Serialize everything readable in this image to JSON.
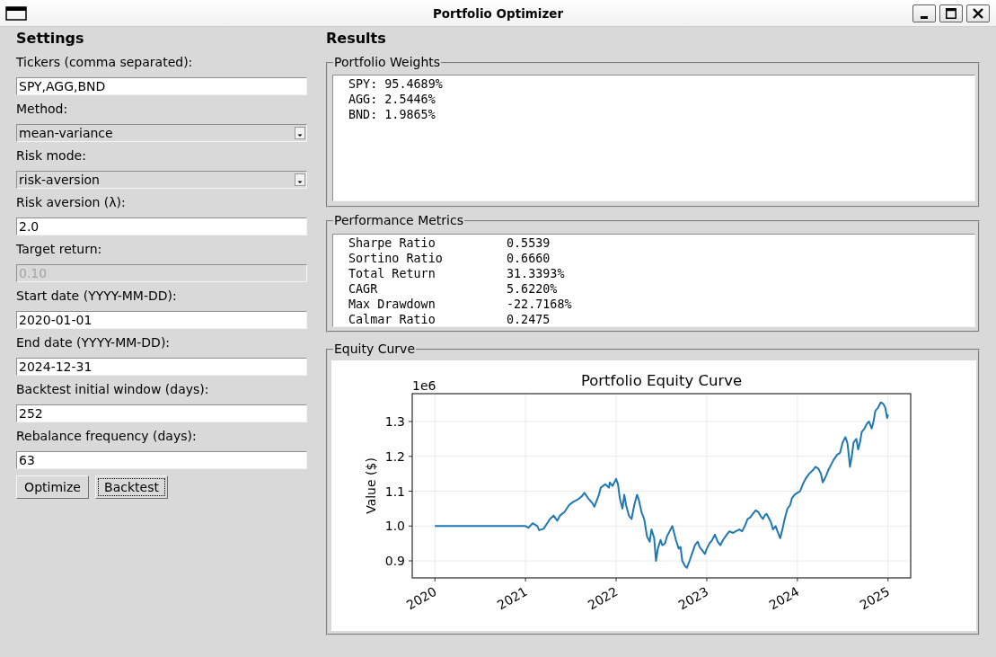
{
  "window": {
    "title": "Portfolio Optimizer"
  },
  "settings": {
    "heading": "Settings",
    "fields": [
      {
        "kind": "entry",
        "label": "Tickers (comma separated):",
        "value": "SPY,AGG,BND",
        "disabled": false
      },
      {
        "kind": "combo",
        "label": "Method:",
        "value": "mean-variance",
        "disabled": false
      },
      {
        "kind": "combo",
        "label": "Risk mode:",
        "value": "risk-aversion",
        "disabled": false
      },
      {
        "kind": "entry",
        "label": "Risk aversion (λ):",
        "value": "2.0",
        "disabled": false
      },
      {
        "kind": "entry",
        "label": "Target return:",
        "value": "0.10",
        "disabled": true
      },
      {
        "kind": "entry",
        "label": "Start date (YYYY-MM-DD):",
        "value": "2020-01-01",
        "disabled": false
      },
      {
        "kind": "entry",
        "label": "End date (YYYY-MM-DD):",
        "value": "2024-12-31",
        "disabled": false
      },
      {
        "kind": "entry",
        "label": "Backtest initial window (days):",
        "value": "252",
        "disabled": false
      },
      {
        "kind": "entry",
        "label": "Rebalance frequency (days):",
        "value": "63",
        "disabled": false
      }
    ],
    "buttons": [
      {
        "label": "Optimize",
        "focused": false
      },
      {
        "label": "Backtest",
        "focused": true
      }
    ]
  },
  "results": {
    "heading": "Results",
    "weights": {
      "title": "Portfolio Weights",
      "lines": [
        "SPY: 95.4689%",
        "AGG: 2.5446%",
        "BND: 1.9865%"
      ]
    },
    "metrics": {
      "title": "Performance Metrics",
      "rows": [
        {
          "name": "Sharpe Ratio",
          "value": "0.5539"
        },
        {
          "name": "Sortino Ratio",
          "value": "0.6660"
        },
        {
          "name": "Total Return",
          "value": "31.3393%"
        },
        {
          "name": "CAGR",
          "value": "5.6220%"
        },
        {
          "name": "Max Drawdown",
          "value": "-22.7168%"
        },
        {
          "name": "Calmar Ratio",
          "value": "0.2475"
        }
      ]
    },
    "equity_curve": {
      "title": "Equity Curve",
      "offset_label": "1e6",
      "chart_data": {
        "type": "line",
        "title": "Portfolio Equity Curve",
        "ylabel": "Value ($)",
        "grid": true,
        "xlim": [
          2019.75,
          2025.25
        ],
        "ylim": [
          0.851,
          1.38
        ],
        "xticks": [
          2020,
          2021,
          2022,
          2023,
          2024,
          2025
        ],
        "yticks": [
          {
            "value": 0.9,
            "label": "0.9"
          },
          {
            "value": 1.0,
            "label": "1.0"
          },
          {
            "value": 1.1,
            "label": "1.1"
          },
          {
            "value": 1.2,
            "label": "1.2"
          },
          {
            "value": 1.3,
            "label": "1.3"
          }
        ],
        "x": [
          2020,
          2021,
          2021.03,
          2021.08,
          2021.13,
          2021.15,
          2021.2,
          2021.22,
          2021.27,
          2021.31,
          2021.35,
          2021.38,
          2021.43,
          2021.48,
          2021.53,
          2021.57,
          2021.62,
          2021.65,
          2021.69,
          2021.74,
          2021.76,
          2021.81,
          2021.83,
          2021.88,
          2021.92,
          2021.93,
          2021.96,
          2022,
          2022.02,
          2022.04,
          2022.07,
          2022.09,
          2022.11,
          2022.14,
          2022.17,
          2022.2,
          2022.23,
          2022.25,
          2022.28,
          2022.31,
          2022.34,
          2022.37,
          2022.39,
          2022.42,
          2022.44,
          2022.46,
          2022.49,
          2022.51,
          2022.54,
          2022.56,
          2022.59,
          2022.62,
          2022.64,
          2022.66,
          2022.69,
          2022.71,
          2022.73,
          2022.76,
          2022.78,
          2022.81,
          2022.83,
          2022.85,
          2022.87,
          2022.9,
          2022.92,
          2022.95,
          2022.98,
          2023,
          2023.03,
          2023.06,
          2023.09,
          2023.12,
          2023.15,
          2023.18,
          2023.22,
          2023.25,
          2023.29,
          2023.32,
          2023.36,
          2023.39,
          2023.42,
          2023.45,
          2023.48,
          2023.51,
          2023.54,
          2023.57,
          2023.59,
          2023.62,
          2023.64,
          2023.66,
          2023.69,
          2023.71,
          2023.73,
          2023.76,
          2023.78,
          2023.81,
          2023.83,
          2023.86,
          2023.89,
          2023.92,
          2023.94,
          2023.97,
          2024,
          2024.03,
          2024.06,
          2024.09,
          2024.13,
          2024.17,
          2024.2,
          2024.23,
          2024.26,
          2024.28,
          2024.31,
          2024.34,
          2024.37,
          2024.4,
          2024.44,
          2024.47,
          2024.5,
          2024.53,
          2024.55,
          2024.56,
          2024.58,
          2024.6,
          2024.62,
          2024.65,
          2024.67,
          2024.69,
          2024.71,
          2024.74,
          2024.77,
          2024.79,
          2024.82,
          2024.84,
          2024.86,
          2024.89,
          2024.92,
          2024.95,
          2024.97,
          2024.99,
          2025
        ],
        "series": [
          {
            "color": "#1f77b4",
            "values": [
              1.0,
              1.0,
              0.995,
              1.008,
              1.0,
              0.988,
              0.992,
              1.0,
              1.02,
              1.03,
              1.015,
              1.03,
              1.04,
              1.06,
              1.07,
              1.075,
              1.085,
              1.095,
              1.08,
              1.065,
              1.055,
              1.09,
              1.11,
              1.12,
              1.11,
              1.125,
              1.115,
              1.135,
              1.12,
              1.08,
              1.05,
              1.09,
              1.06,
              1.03,
              1.02,
              1.06,
              1.09,
              1.075,
              1.04,
              1.02,
              0.97,
              0.955,
              0.99,
              0.965,
              0.9,
              0.935,
              0.96,
              0.945,
              0.95,
              0.97,
              0.985,
              1.0,
              0.98,
              0.96,
              0.935,
              0.94,
              0.9,
              0.885,
              0.88,
              0.9,
              0.915,
              0.93,
              0.945,
              0.955,
              0.94,
              0.93,
              0.92,
              0.935,
              0.95,
              0.96,
              0.975,
              0.955,
              0.945,
              0.96,
              0.975,
              0.985,
              0.98,
              0.985,
              0.99,
              0.985,
              1.0,
              1.02,
              1.025,
              1.035,
              1.045,
              1.04,
              1.03,
              1.02,
              1.03,
              1.035,
              1.02,
              1.01,
              0.99,
              1.0,
              0.985,
              0.965,
              0.985,
              1.02,
              1.05,
              1.06,
              1.08,
              1.09,
              1.095,
              1.1,
              1.12,
              1.135,
              1.15,
              1.16,
              1.17,
              1.165,
              1.15,
              1.125,
              1.14,
              1.16,
              1.175,
              1.19,
              1.205,
              1.21,
              1.24,
              1.255,
              1.24,
              1.22,
              1.17,
              1.2,
              1.24,
              1.25,
              1.22,
              1.24,
              1.27,
              1.28,
              1.295,
              1.3,
              1.28,
              1.3,
              1.33,
              1.34,
              1.355,
              1.35,
              1.34,
              1.31,
              1.32
            ]
          }
        ]
      }
    }
  }
}
